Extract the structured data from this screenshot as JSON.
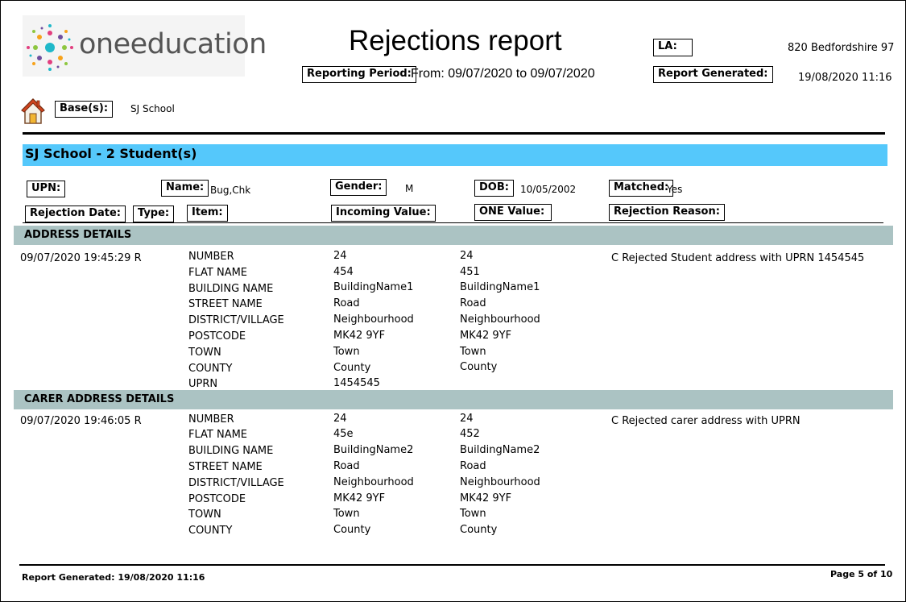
{
  "header": {
    "logo_text": "oneeducation",
    "title": "Rejections report",
    "la_label": "LA:",
    "la_value": "820 Bedfordshire 97",
    "period_label": "Reporting Period:",
    "period_value": "From: 09/07/2020 to 09/07/2020",
    "generated_label": "Report Generated:",
    "generated_value": "19/08/2020 11:16",
    "bases_label": "Base(s):",
    "bases_value": "SJ School",
    "home_icon": "home-icon"
  },
  "school_bar": "SJ School -  2 Student(s)",
  "student": {
    "upn_label": "UPN:",
    "name_label": "Name:",
    "name_value": "Bug,Chk",
    "gender_label": "Gender:",
    "gender_value": "M",
    "dob_label": "DOB:",
    "dob_value": "10/05/2002",
    "matched_label": "Matched:",
    "matched_value": "Yes",
    "rejection_date_label": "Rejection Date:",
    "type_label": "Type:",
    "item_label": "Item:",
    "incoming_label": "Incoming Value:",
    "one_label": "ONE Value:",
    "reason_label": "Rejection Reason:"
  },
  "sections": [
    {
      "title": "ADDRESS DETAILS",
      "date": "09/07/2020  19:45:29 R",
      "reason": "C  Rejected Student address with UPRN 1454545",
      "rows": [
        {
          "item": "NUMBER",
          "incoming": "24",
          "one": "24"
        },
        {
          "item": "FLAT NAME",
          "incoming": "454",
          "one": "451"
        },
        {
          "item": "BUILDING NAME",
          "incoming": "BuildingName1",
          "one": "BuildingName1"
        },
        {
          "item": "STREET NAME",
          "incoming": "Road",
          "one": "Road"
        },
        {
          "item": "DISTRICT/VILLAGE",
          "incoming": "Neighbourhood",
          "one": "Neighbourhood"
        },
        {
          "item": "POSTCODE",
          "incoming": "MK42 9YF",
          "one": "MK42 9YF"
        },
        {
          "item": "TOWN",
          "incoming": "Town",
          "one": "Town"
        },
        {
          "item": "COUNTY",
          "incoming": "County",
          "one": "County"
        },
        {
          "item": "UPRN",
          "incoming": "1454545",
          "one": ""
        }
      ]
    },
    {
      "title": "CARER ADDRESS DETAILS",
      "date": "09/07/2020  19:46:05 R",
      "reason": "C  Rejected carer address with UPRN",
      "rows": [
        {
          "item": "NUMBER",
          "incoming": "24",
          "one": "24"
        },
        {
          "item": "FLAT NAME",
          "incoming": "45e",
          "one": "452"
        },
        {
          "item": "BUILDING NAME",
          "incoming": "BuildingName2",
          "one": "BuildingName2"
        },
        {
          "item": "STREET NAME",
          "incoming": "Road",
          "one": "Road"
        },
        {
          "item": "DISTRICT/VILLAGE",
          "incoming": "Neighbourhood",
          "one": "Neighbourhood"
        },
        {
          "item": "POSTCODE",
          "incoming": "MK42 9YF",
          "one": "MK42 9YF"
        },
        {
          "item": "TOWN",
          "incoming": "Town",
          "one": "Town"
        },
        {
          "item": "COUNTY",
          "incoming": "County",
          "one": "County"
        }
      ]
    }
  ],
  "footer": {
    "generated": "Report Generated: 19/08/2020 11:16",
    "page": "Page 5 of 10"
  },
  "colors": {
    "school_bar": "#55c8fb",
    "section_bar": "#abc3c3",
    "logo_text": "#555555"
  }
}
